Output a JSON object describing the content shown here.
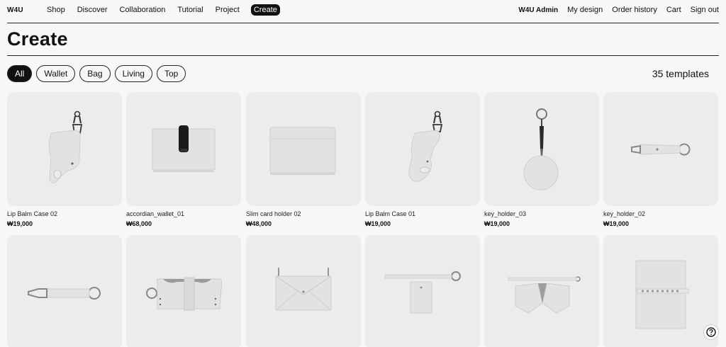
{
  "brand": "W4U",
  "nav": {
    "left": [
      "Shop",
      "Discover",
      "Collaboration",
      "Tutorial",
      "Project",
      "Create"
    ],
    "right": {
      "admin": "W4U Admin",
      "links": [
        "My design",
        "Order history",
        "Cart",
        "Sign out"
      ]
    }
  },
  "page_title": "Create",
  "filters": [
    "All",
    "Wallet",
    "Bag",
    "Living",
    "Top"
  ],
  "active_filter": "All",
  "template_count": "35 templates",
  "products": [
    {
      "name": "Lip Balm Case 02",
      "price": "₩19,000",
      "icon": "lip-balm-case"
    },
    {
      "name": "accordian_wallet_01",
      "price": "₩68,000",
      "icon": "accordion-wallet"
    },
    {
      "name": "Slim card holder 02",
      "price": "₩48,000",
      "icon": "card-holder"
    },
    {
      "name": "Lip Balm Case 01",
      "price": "₩19,000",
      "icon": "lip-balm-case"
    },
    {
      "name": "key_holder_03",
      "price": "₩19,000",
      "icon": "round-key-holder"
    },
    {
      "name": "key_holder_02",
      "price": "₩19,000",
      "icon": "strap-key-holder"
    },
    {
      "name": "",
      "price": "",
      "icon": "long-key-strap"
    },
    {
      "name": "",
      "price": "",
      "icon": "buckle-case"
    },
    {
      "name": "",
      "price": "",
      "icon": "envelope-bag"
    },
    {
      "name": "",
      "price": "",
      "icon": "strap-card-case"
    },
    {
      "name": "",
      "price": "",
      "icon": "folded-bag"
    },
    {
      "name": "",
      "price": "",
      "icon": "notebook-cover"
    }
  ],
  "colors": {
    "background": "#f7f7f7",
    "card": "#ececec",
    "leather": "#e2e2e0",
    "ink": "#111111"
  },
  "help_icon": "question-circle-icon"
}
